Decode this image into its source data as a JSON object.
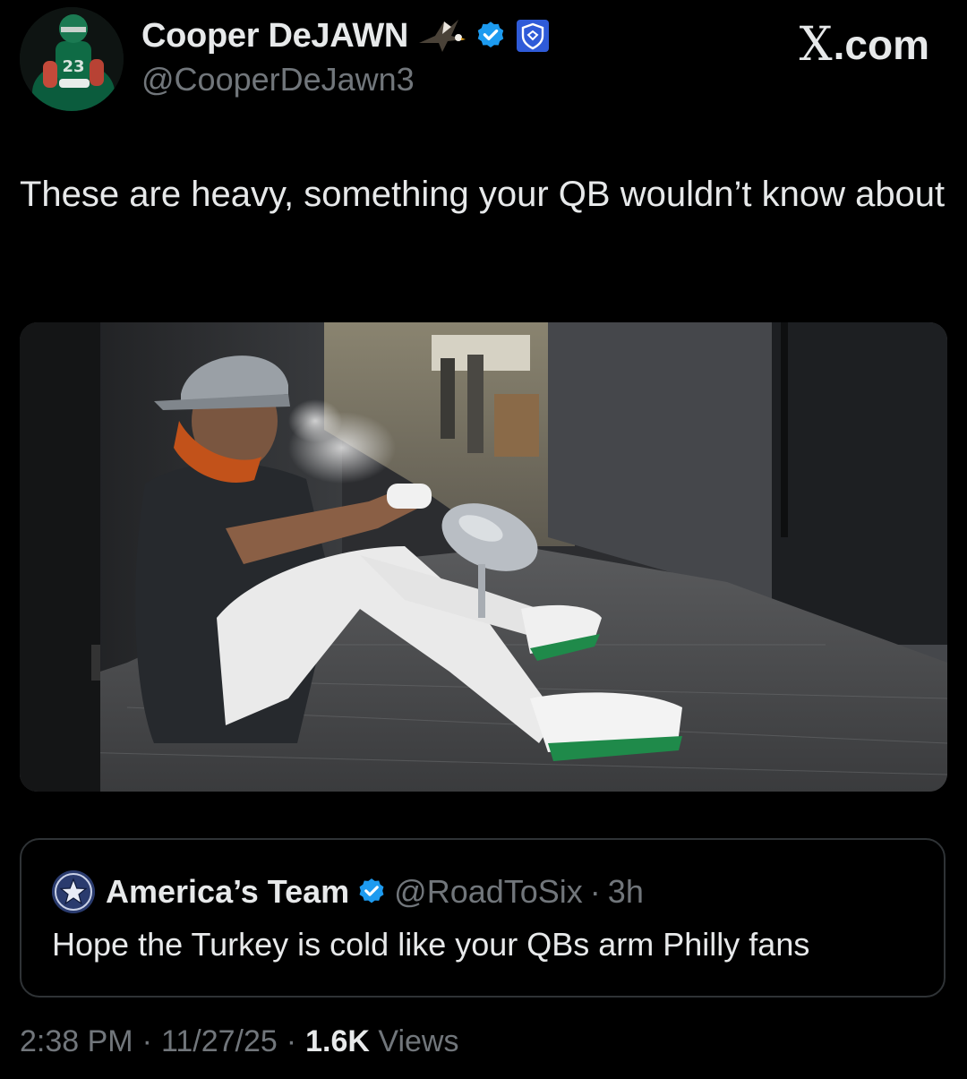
{
  "author": {
    "display_name": "Cooper DeJAWN",
    "handle": "@CooperDeJawn3",
    "badges": [
      "eagle-emoji-icon",
      "verified-badge-icon",
      "shield-badge-icon"
    ]
  },
  "brand": {
    "logo_text": ".com",
    "logo_mark": "X"
  },
  "tweet": {
    "text": "These are heavy, something your QB wouldn’t know about"
  },
  "media": {
    "kind": "photo",
    "icon": "photo-player-with-trophy"
  },
  "quote": {
    "display_name": "America’s Team",
    "handle": "@RoadToSix",
    "separator": "·",
    "time": "3h",
    "text": "Hope the Turkey is cold like your QBs arm Philly fans"
  },
  "meta": {
    "time": "2:38 PM",
    "sep1": "·",
    "date": "11/27/25",
    "sep2": "·",
    "views_count": "1.6K",
    "views_label": "Views"
  },
  "colors": {
    "background": "#000000",
    "text_primary": "#e7e9ea",
    "text_secondary": "#71767b",
    "verified_blue": "#1d9bf0",
    "border": "#2f3336"
  }
}
